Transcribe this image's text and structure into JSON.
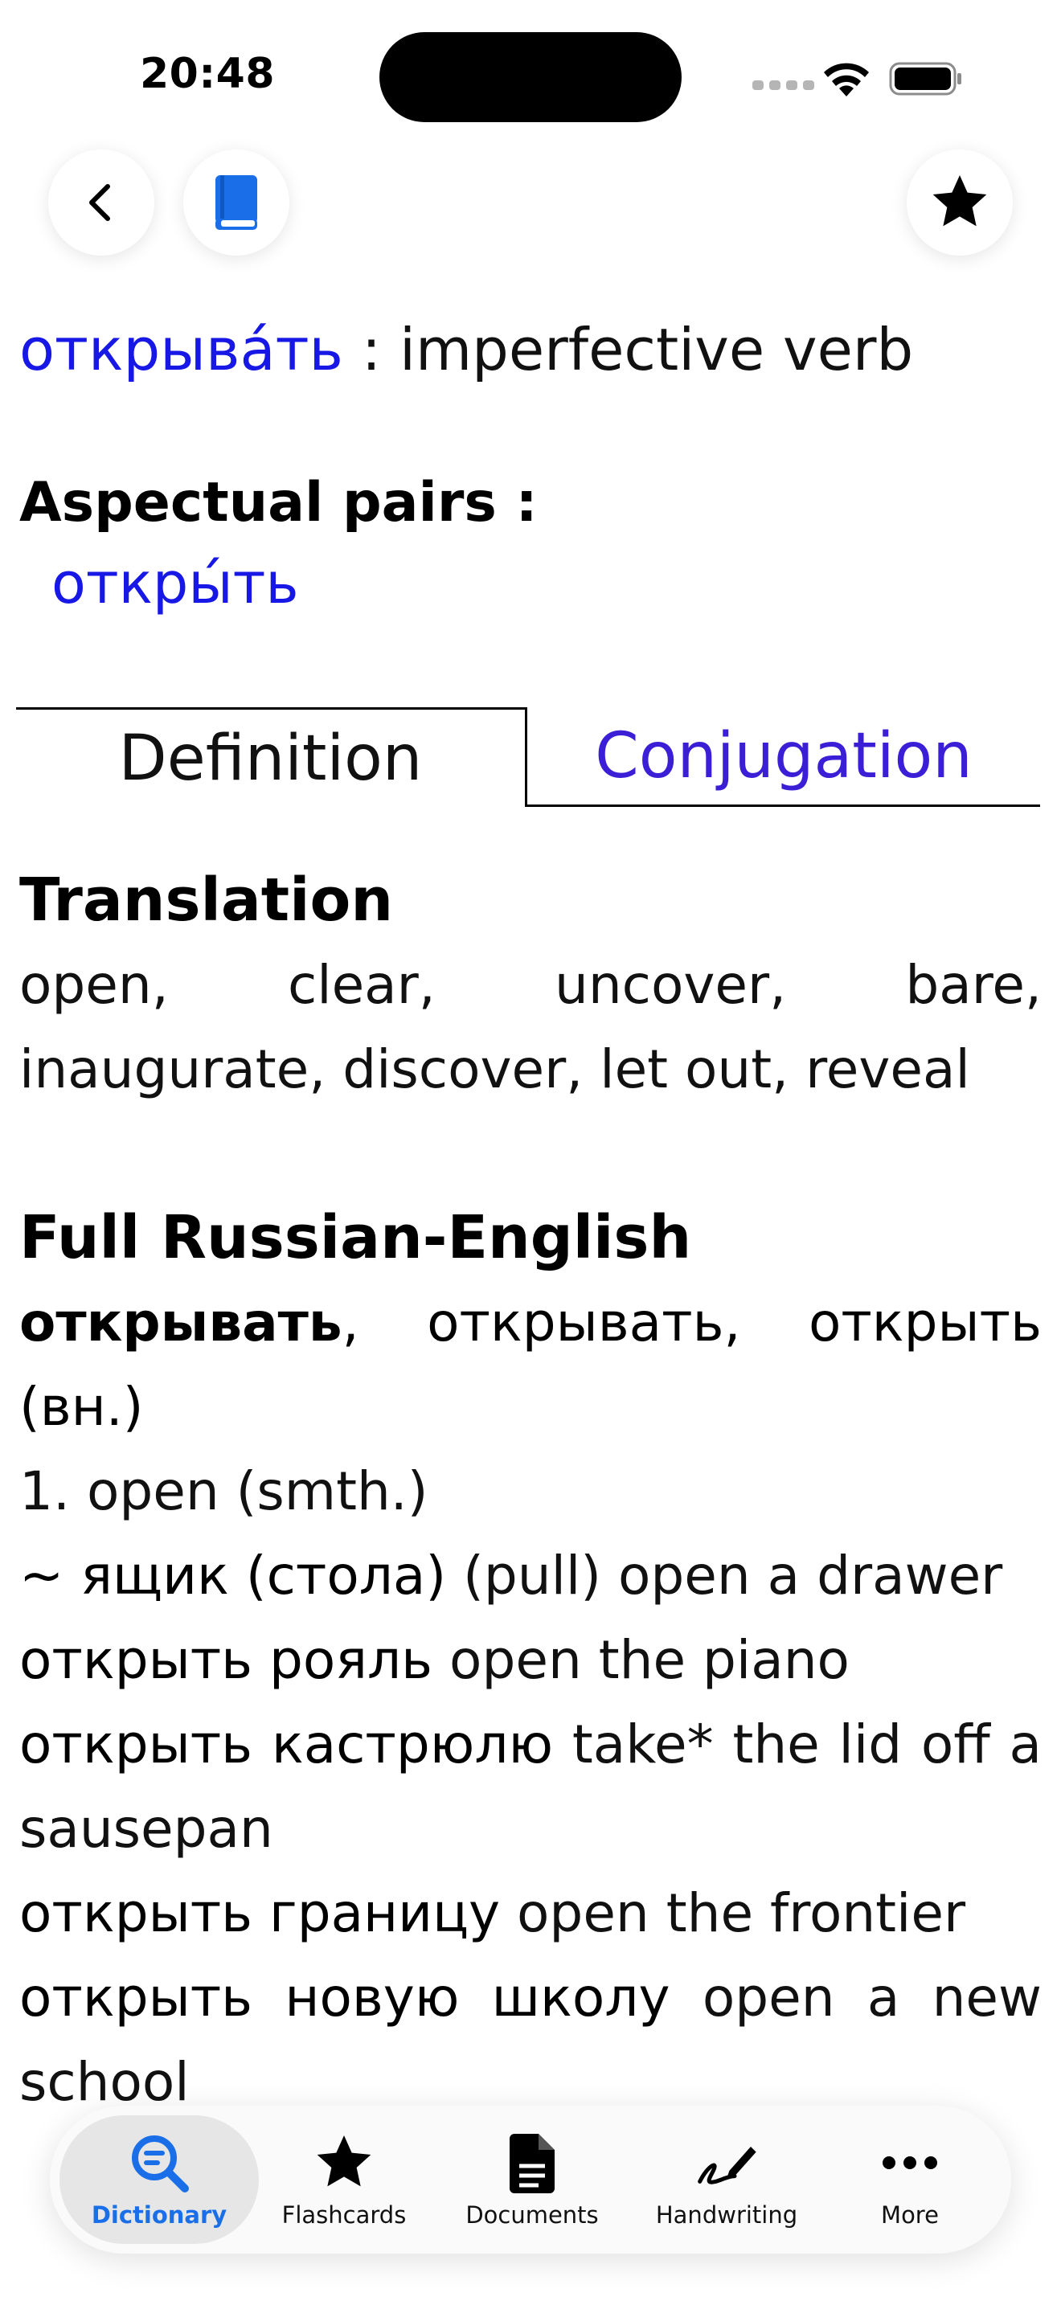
{
  "status_bar": {
    "time": "20:48"
  },
  "nav": {
    "back_icon": "chevron-left-icon",
    "book_icon": "book-icon",
    "favorite_icon": "star-icon",
    "accent_color": "#1a6fe8"
  },
  "entry": {
    "headword": "открыва́ть",
    "separator": " : ",
    "part_of_speech": "imperfective verb",
    "aspectual_pairs_title": "Aspectual pairs :",
    "aspectual_pairs": [
      "откры́ть"
    ]
  },
  "tabs": {
    "definition": "Definition",
    "conjugation": "Conjugation",
    "selected": "Definition"
  },
  "translation": {
    "title": "Translation",
    "text": "open, clear, uncover, bare, inaugurate, discover, let out, reveal"
  },
  "full_dictionary": {
    "title": "Full Russian-English",
    "headline_bold": "открывать",
    "headline_rest": ", открывать, открыть (вн.)",
    "sense_1": "1. open (smth.)",
    "examples": [
      {
        "ru": "~ ящик (стола)",
        "en": " (pull) open a drawer"
      },
      {
        "ru": "открыть рояль",
        "en": " open the piano"
      },
      {
        "ru": "открыть кастрюлю",
        "en": " take* the lid off a sausepan"
      },
      {
        "ru": "открыть границу",
        "en": " open the frontier"
      },
      {
        "ru": "открыть новую школу",
        "en": " open a new school"
      }
    ]
  },
  "tab_bar": {
    "items": [
      {
        "label": "Dictionary",
        "icon": "search-document-icon",
        "active": true
      },
      {
        "label": "Flashcards",
        "icon": "star-icon",
        "active": false
      },
      {
        "label": "Documents",
        "icon": "document-icon",
        "active": false
      },
      {
        "label": "Handwriting",
        "icon": "signature-pen-icon",
        "active": false
      },
      {
        "label": "More",
        "icon": "ellipsis-icon",
        "active": false
      }
    ]
  },
  "colors": {
    "link_blue": "#1818e6",
    "conjugation_tab": "#3b1fd6",
    "active_tab": "#1a6fe8"
  }
}
